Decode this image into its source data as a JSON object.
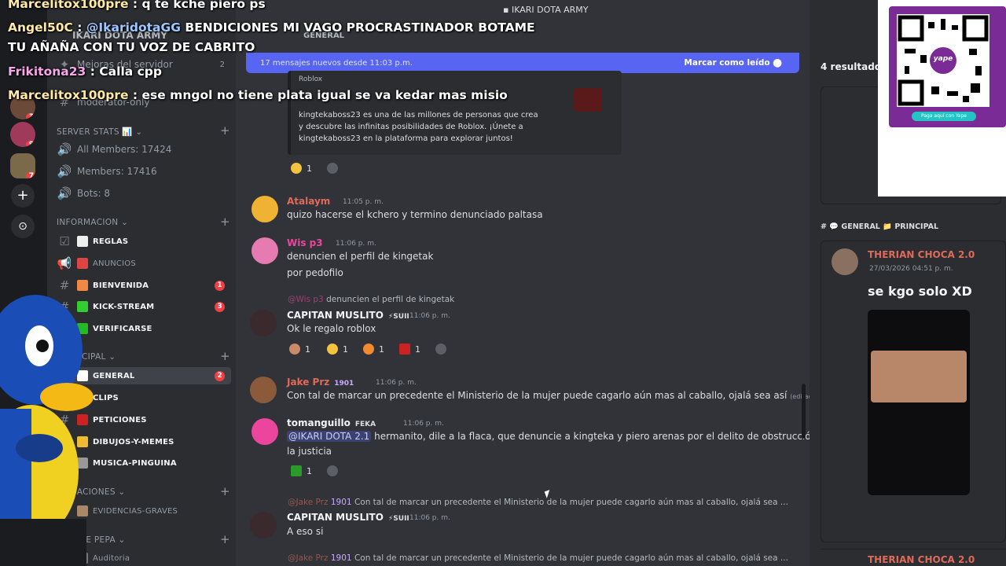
{
  "overlay_chat": [
    {
      "name": "Marcelitox100pre",
      "text": "q te kche piero ps"
    },
    {
      "name": "Angel50C",
      "text": "@IkaridotaGG BENDICIONES MI VAGO PROCRASTINADOR BOTAME"
    },
    {
      "name": "",
      "text": "TU AÑAÑA CON TU VOZ DE CABRITO"
    },
    {
      "name": "Frikitona23",
      "text": "Calla cpp"
    },
    {
      "name": "Marcelitox100pre",
      "text": "ese mngol no tiene plata igual se va kedar mas misio"
    }
  ],
  "window_title": "IKARI DOTA ARMY",
  "server": {
    "name": "IKARI DOTA ARMY",
    "boost_item": "Mejoras del servidor",
    "boost_count": "2",
    "moderator": "moderator-only"
  },
  "sidebar": {
    "stats_category": "SERVER STATS 📊",
    "stats": [
      "All Members: 17424",
      "Members: 17416",
      "Bots: 8"
    ],
    "info_category": "INFORMACION",
    "info_channels": [
      {
        "label": "REGLAS",
        "count": ""
      },
      {
        "label": "ANUNCIOS",
        "count": ""
      },
      {
        "label": "BIENVENIDA",
        "count": "1"
      },
      {
        "label": "KICK-STREAM",
        "count": "3"
      },
      {
        "label": "VERIFICARSE",
        "count": ""
      }
    ],
    "main_category": "PRINCIPAL",
    "main_channels": [
      {
        "label": "GENERAL",
        "count": "2"
      },
      {
        "label": "CLIPS",
        "count": ""
      },
      {
        "label": "PETICIONES",
        "count": ""
      },
      {
        "label": "DIBUJOS-Y-MEMES",
        "count": ""
      },
      {
        "label": "MUSICA-PINGUINA",
        "count": ""
      }
    ],
    "inv_category": "INVESTIGACIONES",
    "inv_channel": "EVIDENCIAS-GRAVES",
    "pepa_category": "EL VIAJE DE PEPA",
    "pepa_channel": "Auditoria"
  },
  "chat": {
    "channel": "GENERAL",
    "new_messages": "17 mensajes nuevos desde 11:03 p.m.",
    "mark_read": "Marcar como leído",
    "embed": {
      "provider": "Roblox",
      "text": "kingtekaboss23 es una de las millones de personas que crea y descubre las infinitas posibilidades de Roblox. ¡Únete a kingtekaboss23 en la plataforma para explorar juntos!"
    },
    "messages": [
      {
        "user": "Atalaym",
        "time": "11:05 p. m.",
        "lines": [
          "quizo hacerse el kchero y termino denunciado paltasa"
        ]
      },
      {
        "user": "Wis p3",
        "time": "11:06 p. m.",
        "lines": [
          "denuncien el perfil de kingetak",
          "por pedofilo"
        ]
      },
      {
        "reply_user": "@Wis p3",
        "reply_text": "denuncien el perfil de kingetak",
        "user": "CAPITAN MUSLITO",
        "tag": "⚡SUII",
        "time": "11:06 p. m.",
        "lines": [
          "Ok le regalo roblox"
        ]
      },
      {
        "user": "Jake Prz",
        "tag": "1901",
        "time": "11:06 p. m.",
        "lines": [
          "Con tal de marcar un precedente el Ministerio de la mujer puede cagarlo aún mas al caballo, ojalá sea así"
        ],
        "edited": "(editado)"
      },
      {
        "user": "tomanguillo",
        "tag": "FEKA",
        "time": "11:06 p. m.",
        "mention": "@IKARI DOTA 2.1",
        "lines": [
          "hermanito, dile a la flaca, que denuncie a kingteka y piero arenas por el delito de obstrucción a",
          "la justicia"
        ]
      },
      {
        "reply_user": "@Jake Prz",
        "reply_tag": "1901",
        "reply_text": "Con tal de marcar un precedente el Ministerio de la mujer puede cagarlo aún mas al caballo, ojalá sea ...",
        "user": "CAPITAN MUSLITO",
        "tag": "⚡SUII",
        "time": "11:06 p. m.",
        "lines": [
          "A eso si"
        ]
      },
      {
        "reply_user": "@Jake Prz",
        "reply_tag": "1901",
        "reply_text": "Con tal de marcar un precedente el Ministerio de la mujer puede cagarlo aún mas al caballo, ojalá sea ..."
      }
    ],
    "reactions": {
      "embed": [
        "1"
      ],
      "muslito": [
        "1",
        "1",
        "1",
        "1"
      ],
      "toman": [
        "1"
      ]
    }
  },
  "right_panel": {
    "results": "4 resultados",
    "channel_path": "GENERAL",
    "folder": "PRINCIPAL",
    "result_user": "THERIAN CHOCA 2.0",
    "result_time": "27/03/2026 04:51 p. m.",
    "result_text": "se kgo solo XD",
    "result_user2": "THERIAN CHOCA 2.0",
    "qr_caption": "Paga aquí con Yape",
    "qr_logo": "yape"
  },
  "colors": {
    "accent": "#5865f2",
    "unread": "#f23f43",
    "online": "#23a55a"
  }
}
